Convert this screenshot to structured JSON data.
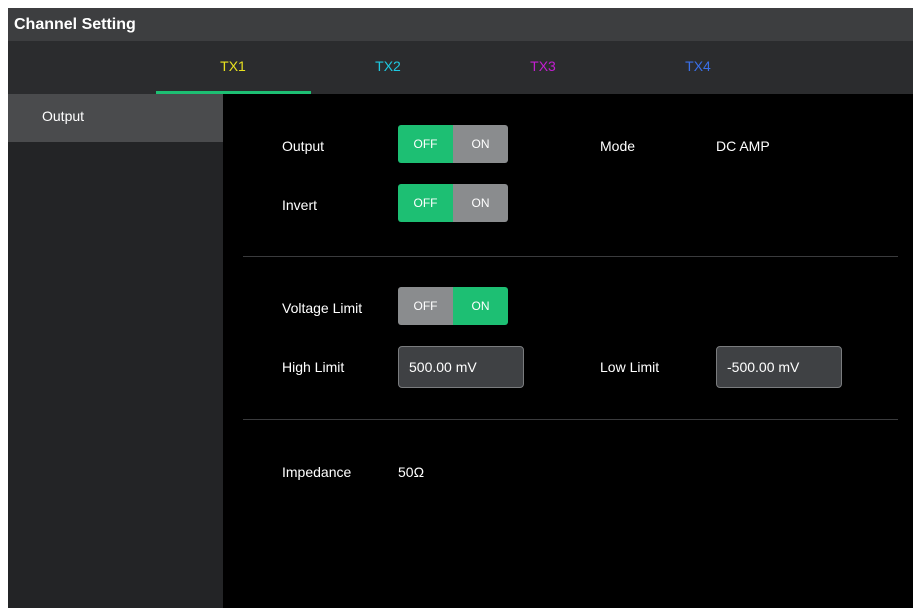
{
  "window": {
    "title": "Channel Setting"
  },
  "tabs": [
    {
      "label": "TX1",
      "color": "#e8e21f",
      "active": true
    },
    {
      "label": "TX2",
      "color": "#1ec8e0"
    },
    {
      "label": "TX3",
      "color": "#c21fd0"
    },
    {
      "label": "TX4",
      "color": "#3a6fe8"
    }
  ],
  "sidebar": {
    "items": [
      {
        "label": "Output",
        "selected": true
      }
    ]
  },
  "output": {
    "output_label": "Output",
    "output_toggle": {
      "off": "OFF",
      "on": "ON",
      "state": "OFF"
    },
    "mode_label": "Mode",
    "mode_value": "DC AMP",
    "invert_label": "Invert",
    "invert_toggle": {
      "off": "OFF",
      "on": "ON",
      "state": "OFF"
    }
  },
  "limits": {
    "voltage_limit_label": "Voltage Limit",
    "voltage_limit_toggle": {
      "off": "OFF",
      "on": "ON",
      "state": "ON"
    },
    "high_limit_label": "High Limit",
    "high_limit_value": "500.00 mV",
    "low_limit_label": "Low Limit",
    "low_limit_value": "-500.00 mV"
  },
  "impedance": {
    "label": "Impedance",
    "value": "50Ω"
  },
  "colors": {
    "accent": "#1dbf73",
    "toggle_inactive": "#8a8c8e",
    "background": "#000000"
  }
}
